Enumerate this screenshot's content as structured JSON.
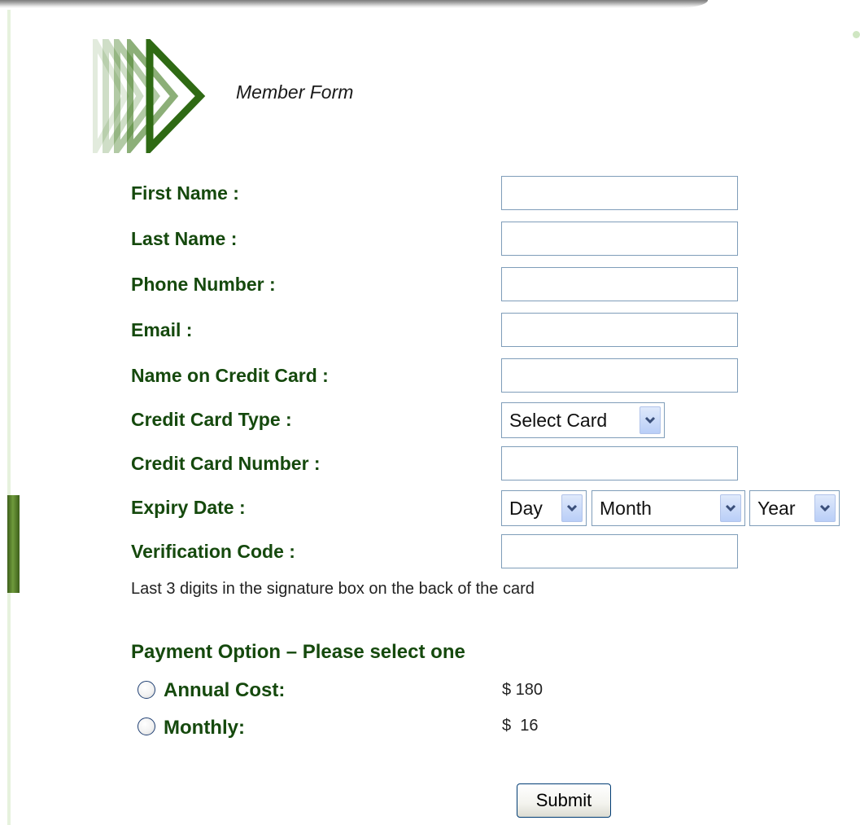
{
  "header": {
    "title": "Member Form"
  },
  "fields": {
    "first_name": {
      "label": "First Name :",
      "value": ""
    },
    "last_name": {
      "label": "Last Name :",
      "value": ""
    },
    "phone": {
      "label": "Phone Number :",
      "value": ""
    },
    "email": {
      "label": "Email :",
      "value": ""
    },
    "card_name": {
      "label": "Name on Credit Card :",
      "value": ""
    },
    "card_type": {
      "label": "Credit Card Type :",
      "selected": "Select Card"
    },
    "card_number": {
      "label": "Credit Card Number :",
      "value": ""
    },
    "expiry": {
      "label": "Expiry Date :",
      "day": "Day",
      "month": "Month",
      "year": "Year"
    },
    "verification": {
      "label": "Verification Code :",
      "value": "",
      "hint": "Last 3 digits in the signature box on the back of the card"
    }
  },
  "payment": {
    "title": "Payment Option – Please select one",
    "options": [
      {
        "label": "Annual Cost:",
        "price": "$ 180",
        "selected": false
      },
      {
        "label": "Monthly:",
        "price": "$  16",
        "selected": false
      }
    ]
  },
  "submit_label": "Submit",
  "colors": {
    "label_green": "#15490d",
    "input_border": "#7f9db9",
    "accent": "#3f7a1e"
  },
  "icons": {
    "logo": "green-chevron-logo",
    "dropdown": "chevron-down-icon"
  }
}
